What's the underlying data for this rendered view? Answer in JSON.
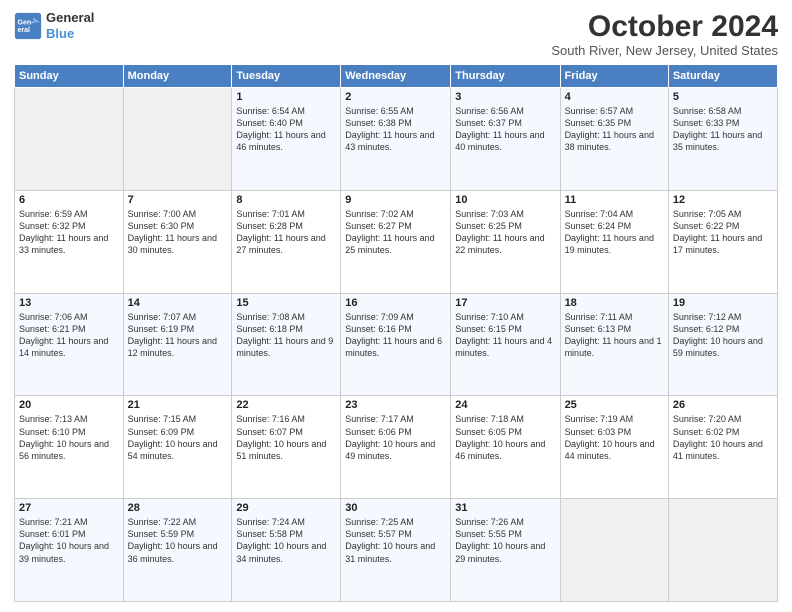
{
  "header": {
    "logo_line1": "General",
    "logo_line2": "Blue",
    "title": "October 2024",
    "subtitle": "South River, New Jersey, United States"
  },
  "days_of_week": [
    "Sunday",
    "Monday",
    "Tuesday",
    "Wednesday",
    "Thursday",
    "Friday",
    "Saturday"
  ],
  "weeks": [
    [
      {
        "day": "",
        "content": ""
      },
      {
        "day": "",
        "content": ""
      },
      {
        "day": "1",
        "content": "Sunrise: 6:54 AM\nSunset: 6:40 PM\nDaylight: 11 hours and 46 minutes."
      },
      {
        "day": "2",
        "content": "Sunrise: 6:55 AM\nSunset: 6:38 PM\nDaylight: 11 hours and 43 minutes."
      },
      {
        "day": "3",
        "content": "Sunrise: 6:56 AM\nSunset: 6:37 PM\nDaylight: 11 hours and 40 minutes."
      },
      {
        "day": "4",
        "content": "Sunrise: 6:57 AM\nSunset: 6:35 PM\nDaylight: 11 hours and 38 minutes."
      },
      {
        "day": "5",
        "content": "Sunrise: 6:58 AM\nSunset: 6:33 PM\nDaylight: 11 hours and 35 minutes."
      }
    ],
    [
      {
        "day": "6",
        "content": "Sunrise: 6:59 AM\nSunset: 6:32 PM\nDaylight: 11 hours and 33 minutes."
      },
      {
        "day": "7",
        "content": "Sunrise: 7:00 AM\nSunset: 6:30 PM\nDaylight: 11 hours and 30 minutes."
      },
      {
        "day": "8",
        "content": "Sunrise: 7:01 AM\nSunset: 6:28 PM\nDaylight: 11 hours and 27 minutes."
      },
      {
        "day": "9",
        "content": "Sunrise: 7:02 AM\nSunset: 6:27 PM\nDaylight: 11 hours and 25 minutes."
      },
      {
        "day": "10",
        "content": "Sunrise: 7:03 AM\nSunset: 6:25 PM\nDaylight: 11 hours and 22 minutes."
      },
      {
        "day": "11",
        "content": "Sunrise: 7:04 AM\nSunset: 6:24 PM\nDaylight: 11 hours and 19 minutes."
      },
      {
        "day": "12",
        "content": "Sunrise: 7:05 AM\nSunset: 6:22 PM\nDaylight: 11 hours and 17 minutes."
      }
    ],
    [
      {
        "day": "13",
        "content": "Sunrise: 7:06 AM\nSunset: 6:21 PM\nDaylight: 11 hours and 14 minutes."
      },
      {
        "day": "14",
        "content": "Sunrise: 7:07 AM\nSunset: 6:19 PM\nDaylight: 11 hours and 12 minutes."
      },
      {
        "day": "15",
        "content": "Sunrise: 7:08 AM\nSunset: 6:18 PM\nDaylight: 11 hours and 9 minutes."
      },
      {
        "day": "16",
        "content": "Sunrise: 7:09 AM\nSunset: 6:16 PM\nDaylight: 11 hours and 6 minutes."
      },
      {
        "day": "17",
        "content": "Sunrise: 7:10 AM\nSunset: 6:15 PM\nDaylight: 11 hours and 4 minutes."
      },
      {
        "day": "18",
        "content": "Sunrise: 7:11 AM\nSunset: 6:13 PM\nDaylight: 11 hours and 1 minute."
      },
      {
        "day": "19",
        "content": "Sunrise: 7:12 AM\nSunset: 6:12 PM\nDaylight: 10 hours and 59 minutes."
      }
    ],
    [
      {
        "day": "20",
        "content": "Sunrise: 7:13 AM\nSunset: 6:10 PM\nDaylight: 10 hours and 56 minutes."
      },
      {
        "day": "21",
        "content": "Sunrise: 7:15 AM\nSunset: 6:09 PM\nDaylight: 10 hours and 54 minutes."
      },
      {
        "day": "22",
        "content": "Sunrise: 7:16 AM\nSunset: 6:07 PM\nDaylight: 10 hours and 51 minutes."
      },
      {
        "day": "23",
        "content": "Sunrise: 7:17 AM\nSunset: 6:06 PM\nDaylight: 10 hours and 49 minutes."
      },
      {
        "day": "24",
        "content": "Sunrise: 7:18 AM\nSunset: 6:05 PM\nDaylight: 10 hours and 46 minutes."
      },
      {
        "day": "25",
        "content": "Sunrise: 7:19 AM\nSunset: 6:03 PM\nDaylight: 10 hours and 44 minutes."
      },
      {
        "day": "26",
        "content": "Sunrise: 7:20 AM\nSunset: 6:02 PM\nDaylight: 10 hours and 41 minutes."
      }
    ],
    [
      {
        "day": "27",
        "content": "Sunrise: 7:21 AM\nSunset: 6:01 PM\nDaylight: 10 hours and 39 minutes."
      },
      {
        "day": "28",
        "content": "Sunrise: 7:22 AM\nSunset: 5:59 PM\nDaylight: 10 hours and 36 minutes."
      },
      {
        "day": "29",
        "content": "Sunrise: 7:24 AM\nSunset: 5:58 PM\nDaylight: 10 hours and 34 minutes."
      },
      {
        "day": "30",
        "content": "Sunrise: 7:25 AM\nSunset: 5:57 PM\nDaylight: 10 hours and 31 minutes."
      },
      {
        "day": "31",
        "content": "Sunrise: 7:26 AM\nSunset: 5:55 PM\nDaylight: 10 hours and 29 minutes."
      },
      {
        "day": "",
        "content": ""
      },
      {
        "day": "",
        "content": ""
      }
    ]
  ]
}
